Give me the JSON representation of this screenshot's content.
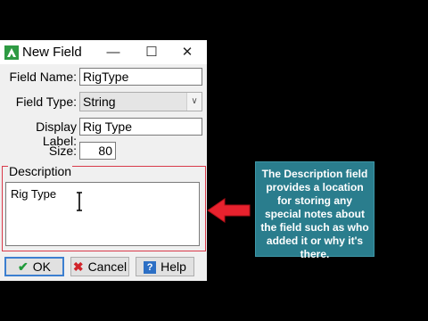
{
  "window": {
    "title": "New Field",
    "app_icon": "arcgis-logo-icon"
  },
  "titlebar": {
    "minimize": "—",
    "maximize": "☐",
    "close": "✕"
  },
  "form": {
    "field_name_label": "Field Name:",
    "field_name_value": "RigType",
    "field_type_label": "Field Type:",
    "field_type_value": "String",
    "display_label_label": "Display Label:",
    "display_label_value": "Rig Type",
    "size_label": "Size:",
    "size_value": "80"
  },
  "description": {
    "label": "Description",
    "value": "Rig Type"
  },
  "buttons": {
    "ok": "OK",
    "cancel": "Cancel",
    "help": "Help"
  },
  "callout": {
    "text": "The Description field provides a location for storing any special notes about the field such as who added it or why it's there."
  },
  "colors": {
    "highlight": "#d93a4a",
    "callout_bg": "#2a7d8d",
    "arrow": "#e8222e"
  }
}
